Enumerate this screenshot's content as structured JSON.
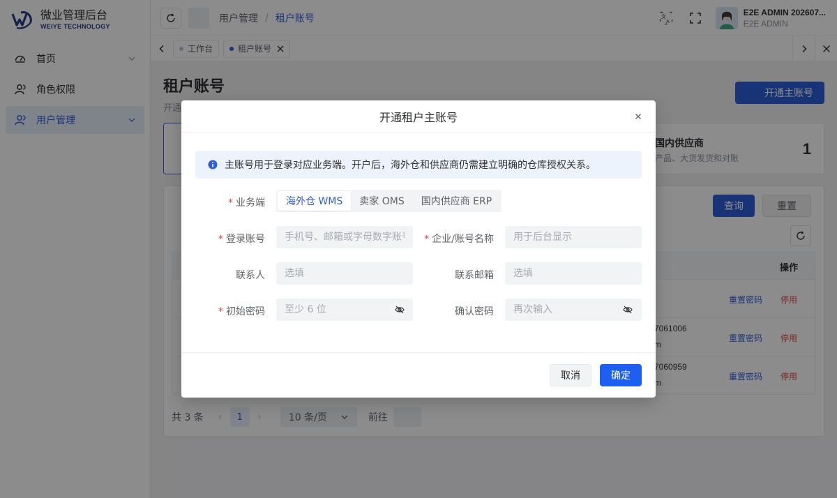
{
  "brand": {
    "title": "微业管理后台",
    "subtitle": "WEIYE TECHNOLOGY",
    "color": "#2b3f8a"
  },
  "sidebar": {
    "items": [
      {
        "label": "首页"
      },
      {
        "label": "角色权限"
      },
      {
        "label": "用户管理"
      }
    ]
  },
  "header": {
    "breadcrumb": [
      "用户管理",
      "/",
      "租户账号"
    ],
    "user_name": "E2E ADMIN 202607...",
    "user_role": "E2E ADMIN"
  },
  "tabs": [
    {
      "label": "工作台"
    },
    {
      "label": "租户账号"
    }
  ],
  "page": {
    "title": "租户账号",
    "subtitle": "开通",
    "open_button": "开通主账号",
    "card": {
      "title": "国内供应商",
      "desc": "产品、大货发货和对账",
      "count": "1"
    },
    "query_button": "查询",
    "reset_button": "重置",
    "table_header_op": "操作",
    "rows": [
      {
        "line1": "",
        "line2": "",
        "reset": "重置密码",
        "disable": "停用"
      },
      {
        "line1": "7061006",
        "line2": "m",
        "reset": "重置密码",
        "disable": "停用"
      },
      {
        "line1": "7060959",
        "line2": "m",
        "reset": "重置密码",
        "disable": "停用"
      }
    ],
    "pager": {
      "total": "共 3 条",
      "page": "1",
      "size": "10 条/页",
      "goto": "前往"
    }
  },
  "dialog": {
    "title": "开通租户主账号",
    "notice": "主账号用于登录对应业务端。开户后，海外仓和供应商仍需建立明确的仓库授权关系。",
    "business_label": "业务端",
    "business_options": [
      "海外仓 WMS",
      "卖家 OMS",
      "国内供应商 ERP"
    ],
    "login_label": "登录账号",
    "login_placeholder": "手机号、邮箱或字母数字账号",
    "company_label": "企业/账号名称",
    "company_placeholder": "用于后台显示",
    "contact_label": "联系人",
    "contact_placeholder": "选填",
    "email_label": "联系邮箱",
    "email_placeholder": "选填",
    "password_label": "初始密码",
    "password_placeholder": "至少 6 位",
    "confirm_label": "确认密码",
    "confirm_placeholder": "再次输入",
    "cancel": "取消",
    "ok": "确定"
  },
  "colors": {
    "primary": "#2f5fd8",
    "danger": "#e04848",
    "ok_button": "#1e5ef0"
  }
}
